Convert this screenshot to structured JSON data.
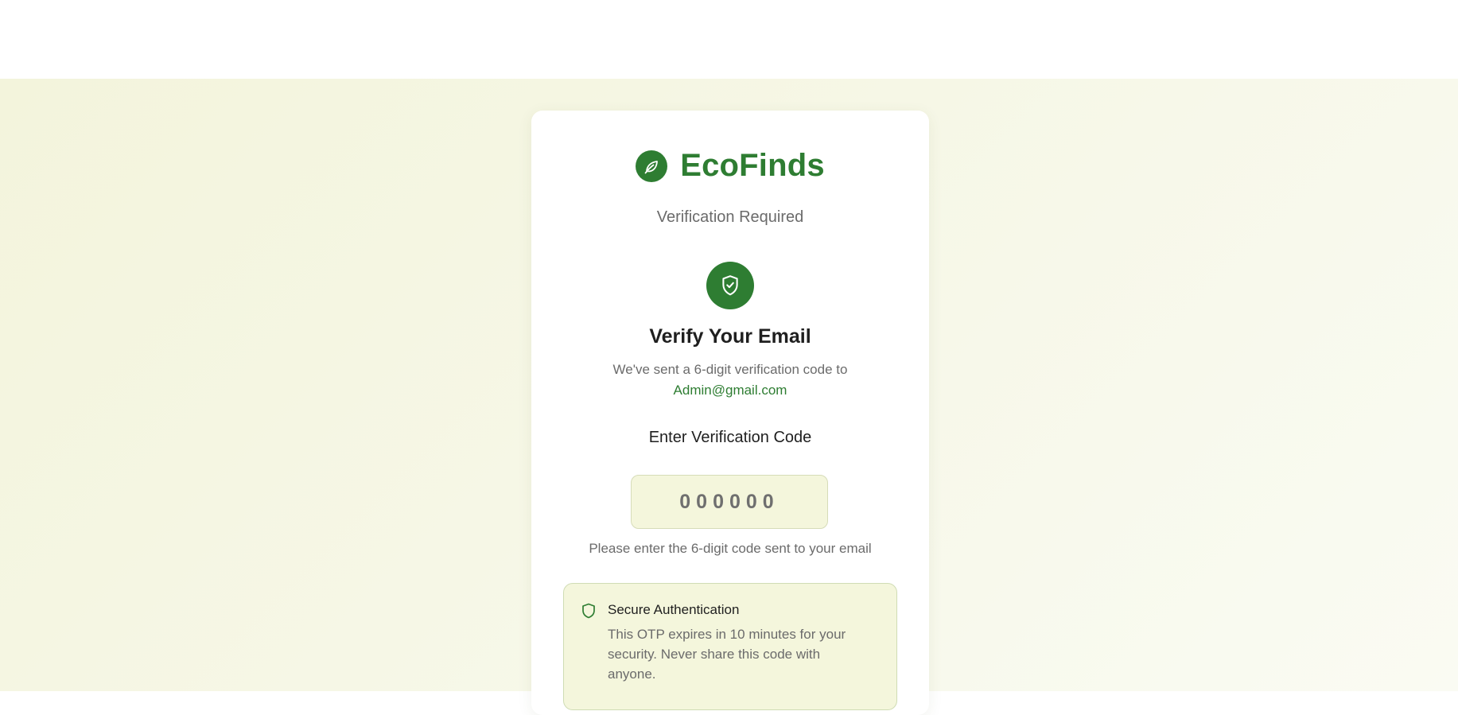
{
  "brand": {
    "name": "EcoFinds",
    "logo_icon": "leaf-icon",
    "color": "#2e7d32"
  },
  "subtitle": "Verification Required",
  "verify": {
    "icon": "shield-check-icon",
    "title": "Verify Your Email",
    "sent_text": "We've sent a 6-digit verification code to",
    "email": "Admin@gmail.com"
  },
  "code": {
    "label": "Enter Verification Code",
    "value": "",
    "placeholder": "000000",
    "hint": "Please enter the 6-digit code sent to your email"
  },
  "info": {
    "icon": "shield-icon",
    "title": "Secure Authentication",
    "text": "This OTP expires in 10 minutes for your security. Never share this code with anyone."
  },
  "colors": {
    "accent": "#2e7d32",
    "input_bg": "#f4f6dc",
    "page_bg": "#f5f6e1"
  }
}
